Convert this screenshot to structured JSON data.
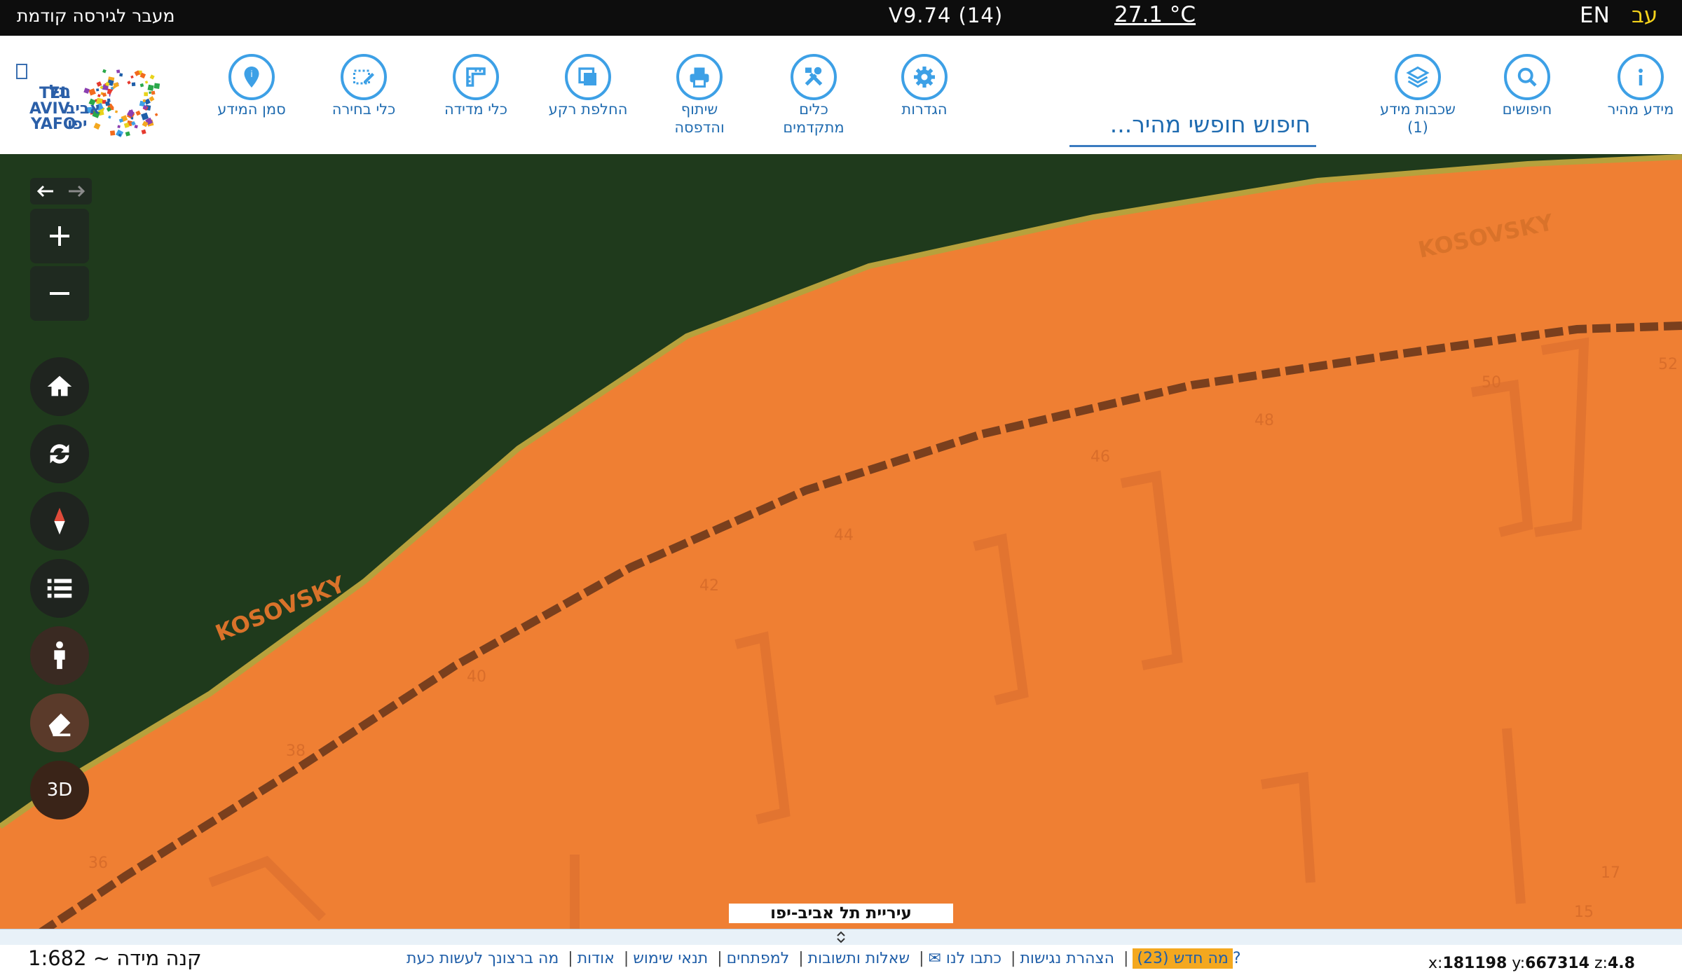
{
  "topbar": {
    "prev_version": "מעבר לגירסה קודמת",
    "version": "V9.74 (14)",
    "temperature": "27.1 °C",
    "lang_en": "EN",
    "lang_he": "עב"
  },
  "toolbar": {
    "quick_info": "מידע מהיר",
    "searches": "חיפושים",
    "layers": "שכבות מידע",
    "layers_count": "(1)",
    "search_placeholder": "חיפוש חופשי מהיר...",
    "settings": "הגדרות",
    "advanced_tools_1": "כלים",
    "advanced_tools_2": "מתקדמים",
    "share_print_1": "שיתוף",
    "share_print_2": "והדפסה",
    "basemap": "החלפת רקע",
    "measure": "כלי מדידה",
    "select": "כלי בחירה",
    "info_marker": "סמן המידע",
    "logo_text_he1": "תל",
    "logo_text_he2": "אביב",
    "logo_text_he3": "יפו",
    "logo_text_en1": "TEL",
    "logo_text_en2": "AVIV",
    "logo_text_en3": "YAFO"
  },
  "map": {
    "street_label": "KOSOVSKY",
    "municipality": "עיריית תל אביב-יפו",
    "house_numbers": [
      "36",
      "38",
      "40",
      "42",
      "44",
      "46",
      "48",
      "50",
      "52",
      "17",
      "15"
    ],
    "control_3d": "3D"
  },
  "bottom": {
    "scale": "קנה מידה ~ 1:682",
    "links": [
      "מה ברצונך לעשות כעת?",
      "אודות",
      "תנאי שימוש",
      "למפתחים",
      "שאלות ותשובות",
      "כתבו לנו ✉",
      "הצהרת נגישות"
    ],
    "news": "מה חדש (23)",
    "coord_x_label": "x:",
    "coord_x": "181198",
    "coord_y_label": "y:",
    "coord_y": "667314",
    "coord_z_label": "z:",
    "coord_z": "4.8"
  },
  "colors": {
    "accent": "#3da0e6",
    "map_orange": "#ef7f33",
    "map_green": "#1f3a1c",
    "news_bg": "#f4a81f"
  }
}
